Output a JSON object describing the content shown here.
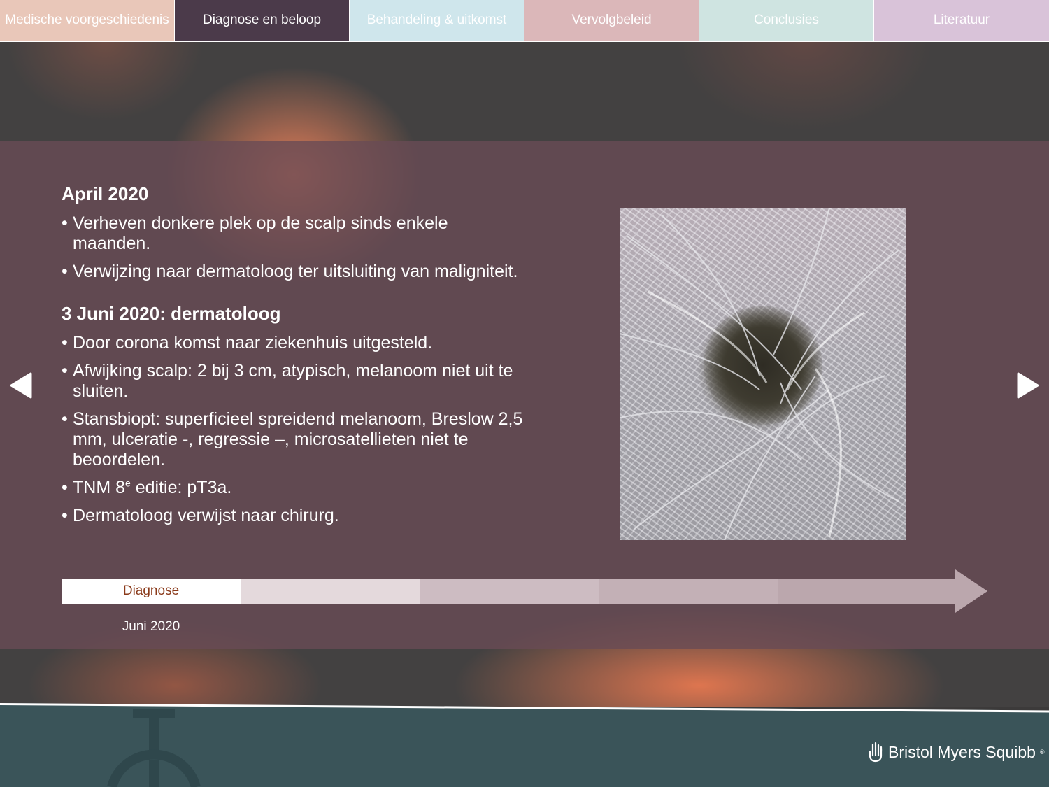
{
  "nav": {
    "tabs": [
      {
        "label": "Medische voorgeschiedenis"
      },
      {
        "label": "Diagnose en beloop"
      },
      {
        "label": "Behandeling & uitkomst"
      },
      {
        "label": "Vervolgbeleid"
      },
      {
        "label": "Conclusies"
      },
      {
        "label": "Literatuur"
      }
    ],
    "active_index": 1
  },
  "content": {
    "section1": {
      "title": "April 2020",
      "bullets": [
        "Verheven donkere plek op de scalp sinds enkele maanden.",
        "Verwijzing naar dermatoloog ter uitsluiting van maligniteit."
      ]
    },
    "section2": {
      "title": "3 Juni 2020: dermatoloog",
      "bullets": [
        "Door corona komst naar ziekenhuis uitgesteld.",
        "Afwijking scalp: 2 bij 3 cm, atypisch, melanoom niet uit te sluiten.",
        "Stansbiopt: superficieel spreidend melanoom, Breslow 2,5 mm, ulceratie -, regressie –, microsatellieten niet te beoordelen.",
        "Dermatoloog verwijst naar chirurg."
      ],
      "tnm": {
        "prefix": "TNM 8",
        "sup": "e",
        "suffix": " editie: pT3a."
      }
    }
  },
  "timeline": {
    "active_label": "Diagnose",
    "active_date": "Juni 2020"
  },
  "footer": {
    "brand": "Bristol Myers Squibb",
    "brand_mark": "®"
  },
  "colors": {
    "tab_active": "#4b3a4a",
    "footer": "#3a5459",
    "timeline_label": "#8a3a1a"
  }
}
